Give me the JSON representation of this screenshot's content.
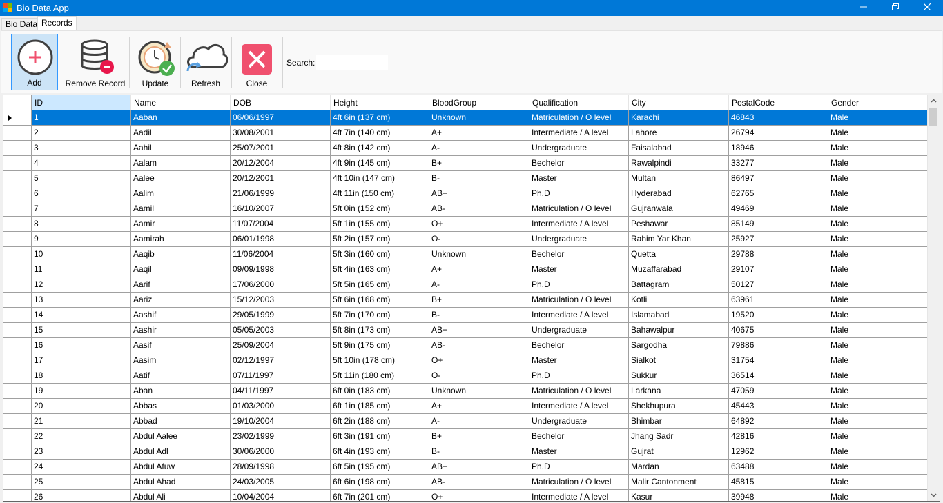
{
  "window": {
    "title": "Bio Data App"
  },
  "tabs": [
    {
      "label": "Bio Data"
    },
    {
      "label": "Records"
    }
  ],
  "toolbar": {
    "add_label": "Add",
    "remove_label": "Remove Record",
    "update_label": "Update",
    "refresh_label": "Refresh",
    "close_label": "Close",
    "search_label": "Search:",
    "search_value": ""
  },
  "grid": {
    "columns": [
      "ID",
      "Name",
      "DOB",
      "Height",
      "BloodGroup",
      "Qualification",
      "City",
      "PostalCode",
      "Gender"
    ],
    "selected_row": 0,
    "rows": [
      [
        "1",
        "Aaban",
        "06/06/1997",
        "4ft 6in (137 cm)",
        "Unknown",
        "Matriculation / O level",
        "Karachi",
        "46843",
        "Male"
      ],
      [
        "2",
        "Aadil",
        "30/08/2001",
        "4ft 7in (140 cm)",
        "A+",
        "Intermediate / A level",
        "Lahore",
        "26794",
        "Male"
      ],
      [
        "3",
        "Aahil",
        "25/07/2001",
        "4ft 8in (142 cm)",
        "A-",
        "Undergraduate",
        "Faisalabad",
        "18946",
        "Male"
      ],
      [
        "4",
        "Aalam",
        "20/12/2004",
        "4ft 9in (145 cm)",
        "B+",
        "Bechelor",
        "Rawalpindi",
        "33277",
        "Male"
      ],
      [
        "5",
        "Aalee",
        "20/12/2001",
        "4ft 10in (147 cm)",
        "B-",
        "Master",
        "Multan",
        "86497",
        "Male"
      ],
      [
        "6",
        "Aalim",
        "21/06/1999",
        "4ft 11in (150 cm)",
        "AB+",
        "Ph.D",
        "Hyderabad",
        "62765",
        "Male"
      ],
      [
        "7",
        "Aamil",
        "16/10/2007",
        "5ft 0in (152 cm)",
        "AB-",
        "Matriculation / O level",
        "Gujranwala",
        "49469",
        "Male"
      ],
      [
        "8",
        "Aamir",
        "11/07/2004",
        "5ft 1in (155 cm)",
        "O+",
        "Intermediate / A level",
        "Peshawar",
        "85149",
        "Male"
      ],
      [
        "9",
        "Aamirah",
        "06/01/1998",
        "5ft 2in (157 cm)",
        "O-",
        "Undergraduate",
        "Rahim Yar Khan",
        "25927",
        "Male"
      ],
      [
        "10",
        "Aaqib",
        "11/06/2004",
        "5ft 3in (160 cm)",
        "Unknown",
        "Bechelor",
        "Quetta",
        "29788",
        "Male"
      ],
      [
        "11",
        "Aaqil",
        "09/09/1998",
        "5ft 4in (163 cm)",
        "A+",
        "Master",
        "Muzaffarabad",
        "29107",
        "Male"
      ],
      [
        "12",
        "Aarif",
        "17/06/2000",
        "5ft 5in (165 cm)",
        "A-",
        "Ph.D",
        "Battagram",
        "50127",
        "Male"
      ],
      [
        "13",
        "Aariz",
        "15/12/2003",
        "5ft 6in (168 cm)",
        "B+",
        "Matriculation / O level",
        "Kotli",
        "63961",
        "Male"
      ],
      [
        "14",
        "Aashif",
        "29/05/1999",
        "5ft 7in (170 cm)",
        "B-",
        "Intermediate / A level",
        "Islamabad",
        "19520",
        "Male"
      ],
      [
        "15",
        "Aashir",
        "05/05/2003",
        "5ft 8in (173 cm)",
        "AB+",
        "Undergraduate",
        "Bahawalpur",
        "40675",
        "Male"
      ],
      [
        "16",
        "Aasif",
        "25/09/2004",
        "5ft 9in (175 cm)",
        "AB-",
        "Bechelor",
        "Sargodha",
        "79886",
        "Male"
      ],
      [
        "17",
        "Aasim",
        "02/12/1997",
        "5ft 10in (178 cm)",
        "O+",
        "Master",
        "Sialkot",
        "31754",
        "Male"
      ],
      [
        "18",
        "Aatif",
        "07/11/1997",
        "5ft 11in (180 cm)",
        "O-",
        "Ph.D",
        "Sukkur",
        "36514",
        "Male"
      ],
      [
        "19",
        "Aban",
        "04/11/1997",
        "6ft 0in (183 cm)",
        "Unknown",
        "Matriculation / O level",
        "Larkana",
        "47059",
        "Male"
      ],
      [
        "20",
        "Abbas",
        "01/03/2000",
        "6ft 1in (185 cm)",
        "A+",
        "Intermediate / A level",
        "Shekhupura",
        "45443",
        "Male"
      ],
      [
        "21",
        "Abbad",
        "19/10/2004",
        "6ft 2in (188 cm)",
        "A-",
        "Undergraduate",
        "Bhimbar",
        "64892",
        "Male"
      ],
      [
        "22",
        "Abdul Aalee",
        "23/02/1999",
        "6ft 3in (191 cm)",
        "B+",
        "Bechelor",
        "Jhang Sadr",
        "42816",
        "Male"
      ],
      [
        "23",
        "Abdul Adl",
        "30/06/2000",
        "6ft 4in (193 cm)",
        "B-",
        "Master",
        "Gujrat",
        "12962",
        "Male"
      ],
      [
        "24",
        "Abdul Afuw",
        "28/09/1998",
        "6ft 5in (195 cm)",
        "AB+",
        "Ph.D",
        "Mardan",
        "63488",
        "Male"
      ],
      [
        "25",
        "Abdul Ahad",
        "24/03/2005",
        "6ft 6in (198 cm)",
        "AB-",
        "Matriculation / O level",
        "Malir Cantonment",
        "45815",
        "Male"
      ],
      [
        "26",
        "Abdul Ali",
        "10/04/2004",
        "6ft 7in (201 cm)",
        "O+",
        "Intermediate / A level",
        "Kasur",
        "39948",
        "Male"
      ]
    ]
  },
  "colors": {
    "titlebar": "#0078d7",
    "selection": "#0078d7",
    "close_button": "#e81123",
    "add_accent": "#f0506e"
  }
}
